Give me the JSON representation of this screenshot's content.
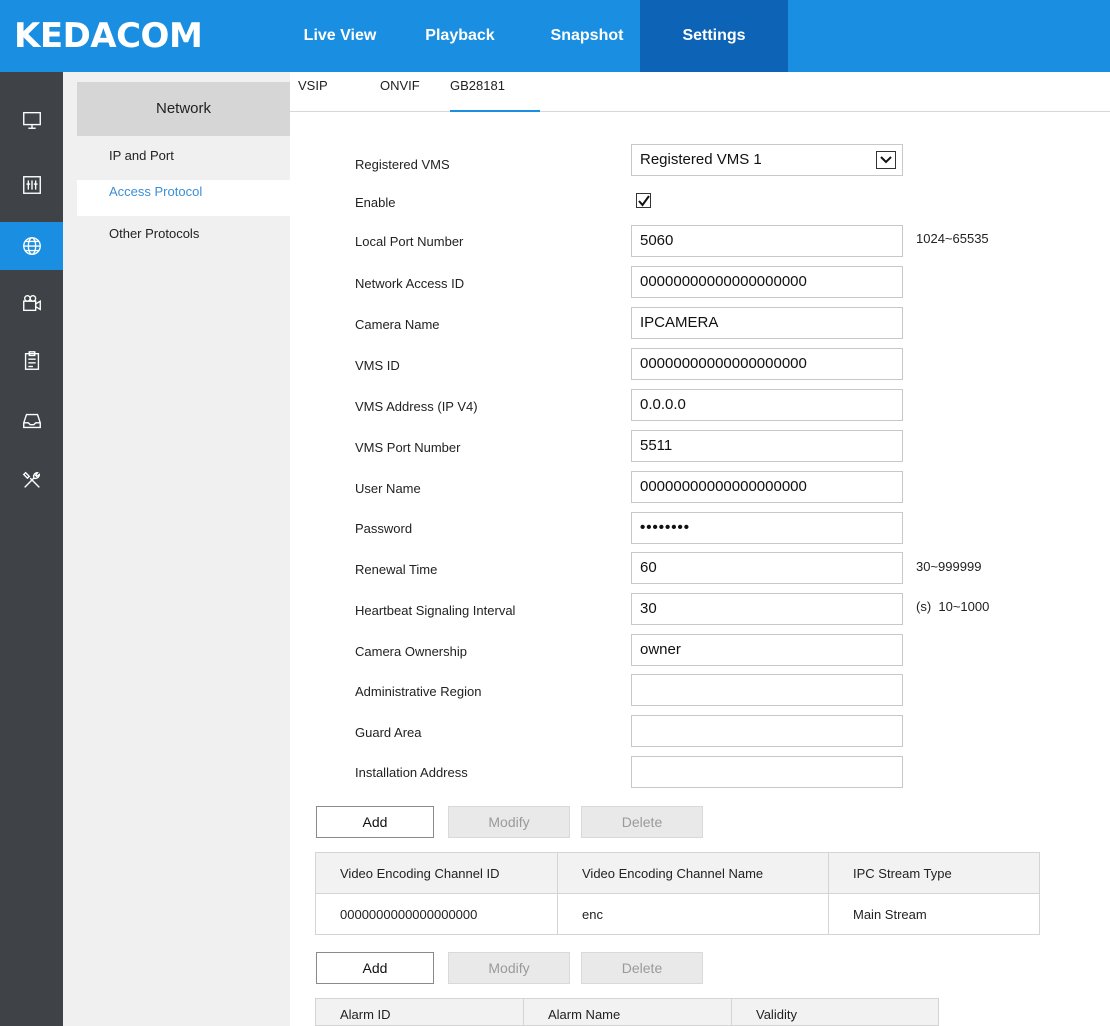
{
  "brand": {
    "logo": "KEDACOM"
  },
  "nav": [
    {
      "label": "Live View",
      "active": false
    },
    {
      "label": "Playback",
      "active": false
    },
    {
      "label": "Snapshot",
      "active": false
    },
    {
      "label": "Settings",
      "active": true
    }
  ],
  "rail_icons": [
    "monitor-icon",
    "sliders-icon",
    "network-globe-icon",
    "camera-icon",
    "clipboard-icon",
    "storage-tray-icon",
    "tools-icon"
  ],
  "submenu": {
    "header": "Network",
    "items": [
      {
        "label": "IP and Port",
        "active": false
      },
      {
        "label": "Access Protocol",
        "active": true
      },
      {
        "label": "Other Protocols",
        "active": false
      }
    ]
  },
  "tabs": [
    {
      "label": "VSIP",
      "active": false
    },
    {
      "label": "ONVIF",
      "active": false
    },
    {
      "label": "GB28181",
      "active": true
    }
  ],
  "form": {
    "registered_vms": {
      "label": "Registered VMS",
      "value": "Registered VMS 1"
    },
    "enable": {
      "label": "Enable",
      "checked": true
    },
    "local_port": {
      "label": "Local Port Number",
      "value": "5060",
      "hint": "1024~65535"
    },
    "network_access_id": {
      "label": "Network Access ID",
      "value": "00000000000000000000"
    },
    "camera_name": {
      "label": "Camera Name",
      "value": "IPCAMERA"
    },
    "vms_id": {
      "label": "VMS ID",
      "value": "00000000000000000000"
    },
    "vms_address": {
      "label": "VMS Address (IP V4)",
      "value": "0.0.0.0"
    },
    "vms_port": {
      "label": "VMS Port Number",
      "value": "5511"
    },
    "user_name": {
      "label": "User Name",
      "value": "00000000000000000000"
    },
    "password": {
      "label": "Password",
      "value": "••••••••"
    },
    "renewal_time": {
      "label": "Renewal Time",
      "value": "60",
      "hint": "30~999999"
    },
    "heartbeat": {
      "label": "Heartbeat Signaling Interval",
      "value": "30",
      "hint": "(s)  10~1000"
    },
    "camera_ownership": {
      "label": "Camera Ownership",
      "value": "owner"
    },
    "admin_region": {
      "label": "Administrative Region",
      "value": ""
    },
    "guard_area": {
      "label": "Guard Area",
      "value": ""
    },
    "install_address": {
      "label": "Installation Address",
      "value": ""
    }
  },
  "actions": {
    "add": "Add",
    "modify": "Modify",
    "delete": "Delete"
  },
  "channel_table": {
    "headers": [
      "Video Encoding Channel ID",
      "Video Encoding Channel Name",
      "IPC Stream Type"
    ],
    "rows": [
      [
        "0000000000000000000",
        "enc",
        "Main Stream"
      ]
    ]
  },
  "alarm_table": {
    "headers": [
      "Alarm ID",
      "Alarm Name",
      "Validity"
    ]
  }
}
